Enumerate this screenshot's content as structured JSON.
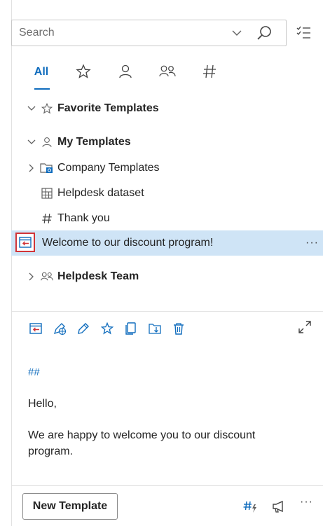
{
  "search": {
    "placeholder": "Search",
    "value": ""
  },
  "tabs": [
    {
      "label": "All",
      "icon": null,
      "active": true
    },
    {
      "label": "",
      "icon": "star-icon"
    },
    {
      "label": "",
      "icon": "person-icon"
    },
    {
      "label": "",
      "icon": "people-icon"
    },
    {
      "label": "",
      "icon": "hash-icon"
    }
  ],
  "tree": {
    "favorites": {
      "label": "Favorite Templates",
      "expanded": true
    },
    "my_templates": {
      "label": "My Templates",
      "expanded": true,
      "items": [
        {
          "label": "Company Templates",
          "icon": "folder-outlook-icon",
          "collapsed": true
        },
        {
          "label": "Helpdesk dataset",
          "icon": "table-icon"
        },
        {
          "label": "Thank you",
          "icon": "hash-icon"
        },
        {
          "label": "Welcome to our discount program!",
          "icon": "insert-template-icon",
          "selected": true,
          "more": "···"
        }
      ]
    },
    "helpdesk_team": {
      "label": "Helpdesk Team",
      "expanded": false
    }
  },
  "toolbar": {
    "buttons": [
      "insert-icon",
      "share-edit-icon",
      "edit-icon",
      "favorite-icon",
      "copy-icon",
      "move-icon",
      "delete-icon"
    ],
    "expand": "expand-icon"
  },
  "preview": {
    "hashes": "##",
    "greeting": "Hello,",
    "body": "We are happy to welcome you to our discount program."
  },
  "footer": {
    "new_template": "New Template",
    "more": "···"
  },
  "colors": {
    "accent": "#0f6cbd",
    "selection": "#cfe4f6",
    "highlight": "#d13438"
  }
}
